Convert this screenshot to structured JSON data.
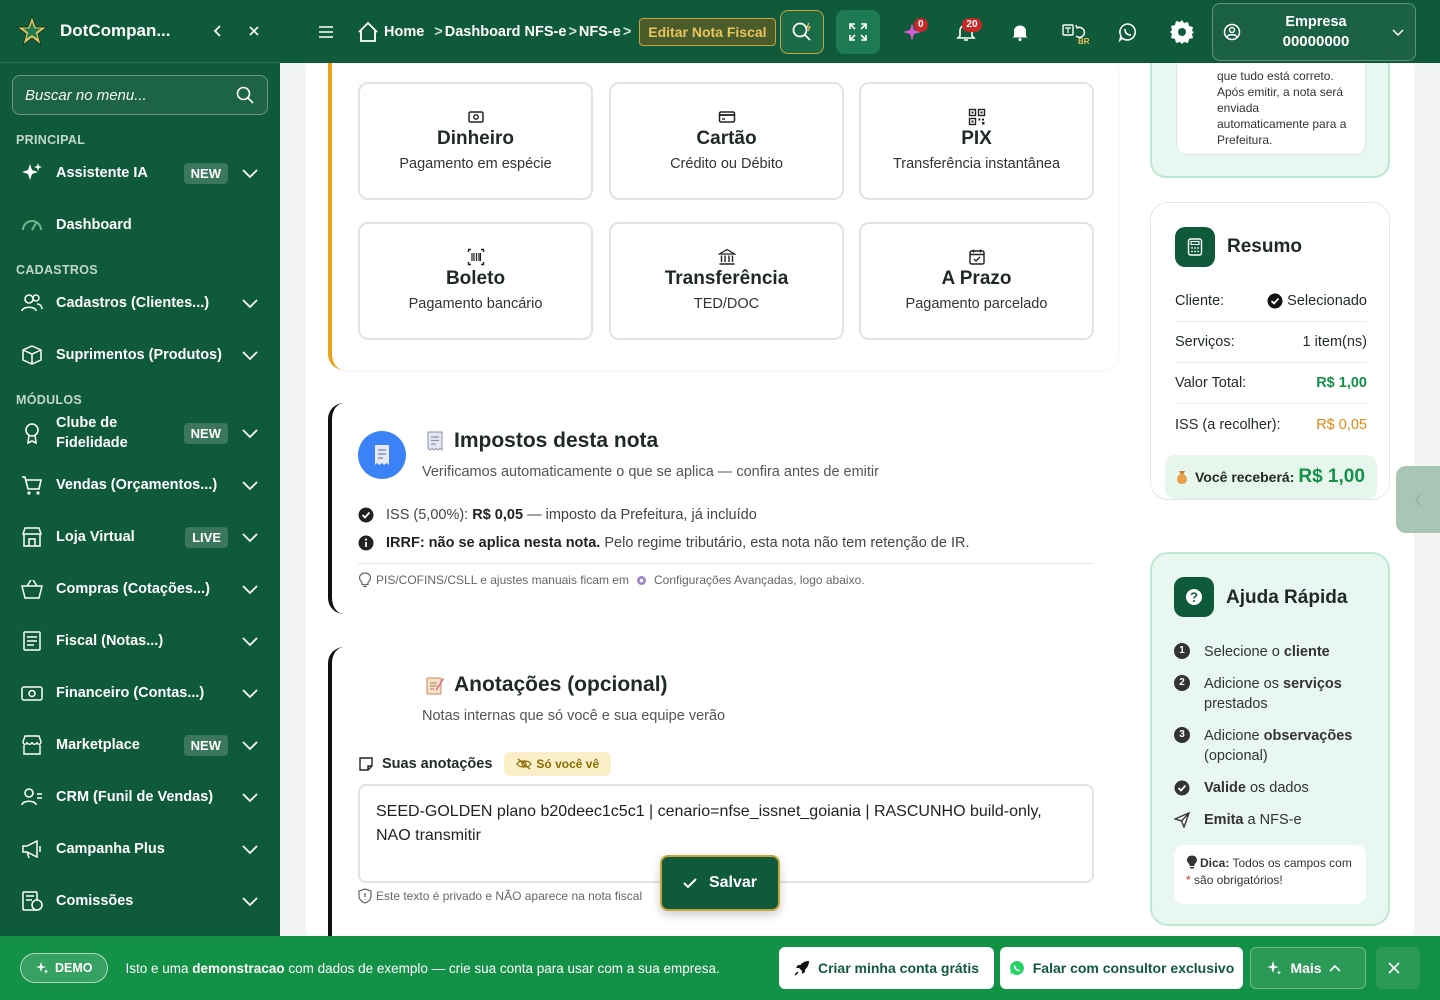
{
  "app": {
    "brand": "DotCompan..."
  },
  "sidebar": {
    "search_placeholder": "Buscar no menu...",
    "sections": {
      "principal": "PRINCIPAL",
      "cadastros": "CADASTROS",
      "modulos": "MÓDULOS"
    },
    "items": [
      {
        "label": "Assistente IA",
        "badge": "NEW",
        "icon": "sparkle-icon"
      },
      {
        "label": "Dashboard",
        "badge": "",
        "icon": "gauge-icon"
      },
      {
        "label": "Cadastros (Clientes...)",
        "badge": "",
        "icon": "users-icon"
      },
      {
        "label": "Suprimentos (Produtos)",
        "badge": "",
        "icon": "box-icon"
      },
      {
        "label": "Clube de Fidelidade",
        "badge": "NEW",
        "icon": "medal-icon"
      },
      {
        "label": "Vendas (Orçamentos...)",
        "badge": "",
        "icon": "cart-icon"
      },
      {
        "label": "Loja Virtual",
        "badge": "LIVE",
        "icon": "store-icon"
      },
      {
        "label": "Compras (Cotações...)",
        "badge": "",
        "icon": "basket-icon"
      },
      {
        "label": "Fiscal (Notas...)",
        "badge": "",
        "icon": "document-icon"
      },
      {
        "label": "Financeiro (Contas...)",
        "badge": "",
        "icon": "money-icon"
      },
      {
        "label": "Marketplace",
        "badge": "NEW",
        "icon": "shop-icon"
      },
      {
        "label": "CRM (Funil de Vendas)",
        "badge": "",
        "icon": "crm-icon"
      },
      {
        "label": "Campanha Plus",
        "badge": "",
        "icon": "megaphone-icon"
      },
      {
        "label": "Comissões",
        "badge": "",
        "icon": "commission-icon"
      }
    ]
  },
  "topbar": {
    "home": "Home",
    "crumbs": [
      "Dashboard NFS-e",
      "NFS-e"
    ],
    "current": "Editar Nota Fiscal",
    "ai_count": "0",
    "notif_count": "20",
    "lang_badge": "BR",
    "company_label": "Empresa",
    "company_id": "00000000"
  },
  "payment": {
    "options": [
      {
        "title": "Dinheiro",
        "subtitle": "Pagamento em espécie",
        "icon": "cash-icon"
      },
      {
        "title": "Cartão",
        "subtitle": "Crédito ou Débito",
        "icon": "card-icon"
      },
      {
        "title": "PIX",
        "subtitle": "Transferência instantânea",
        "icon": "qr-icon"
      },
      {
        "title": "Boleto",
        "subtitle": "Pagamento bancário",
        "icon": "barcode-icon"
      },
      {
        "title": "Transferência",
        "subtitle": "TED/DOC",
        "icon": "bank-icon"
      },
      {
        "title": "A Prazo",
        "subtitle": "Pagamento parcelado",
        "icon": "calendar-icon"
      }
    ]
  },
  "taxes": {
    "title": "Impostos desta nota",
    "subtitle": "Verificamos automaticamente o que se aplica — confira antes de emitir",
    "iss_label": "ISS (5,00%):",
    "iss_value": "R$ 0,05",
    "iss_note": "— imposto da Prefeitura, já incluído",
    "irrf_label": "IRRF: não se aplica nesta nota.",
    "irrf_note": "Pelo regime tributário, esta nota não tem retenção de IR.",
    "hint_a": "PIS/COFINS/CSLL e ajustes manuais ficam em",
    "hint_b": "Configurações Avançadas, logo abaixo."
  },
  "notes": {
    "title": "Anotações (opcional)",
    "subtitle": "Notas internas que só você e sua equipe verão",
    "label": "Suas anotações",
    "private_badge": "Só você vê",
    "value": "SEED-GOLDEN plano b20deec1c5c1 | cenario=nfse_issnet_goiania | RASCUNHO build-only, NAO transmitir",
    "hint": "Este texto é privado e NÃO aparece na nota fiscal",
    "save": "Salvar"
  },
  "top_info": {
    "text": "que tudo está correto. Após emitir, a nota será enviada automaticamente para a Prefeitura."
  },
  "summary": {
    "title": "Resumo",
    "rows": [
      {
        "label": "Cliente:",
        "value": "Selecionado"
      },
      {
        "label": "Serviços:",
        "value": "1 item(ns)"
      },
      {
        "label": "Valor Total:",
        "value": "R$ 1,00"
      },
      {
        "label": "ISS (a recolher):",
        "value": "R$ 0,05"
      }
    ],
    "receive_label": "Você receberá:",
    "receive_value": "R$ 1,00"
  },
  "help": {
    "title": "Ajuda Rápida",
    "steps": [
      {
        "num": "1",
        "pre": "Selecione o ",
        "bold": "cliente",
        "post": ""
      },
      {
        "num": "2",
        "pre": "Adicione os ",
        "bold": "serviços",
        "post": " prestados"
      },
      {
        "num": "3",
        "pre": "Adicione ",
        "bold": "observações",
        "post": " (opcional)"
      },
      {
        "num": "",
        "pre": "",
        "bold": "Valide",
        "post": " os dados"
      },
      {
        "num": "",
        "pre": "",
        "bold": "Emita",
        "post": " a NFS-e"
      }
    ],
    "tip_label": "Dica:",
    "tip_text": "Todos os campos com",
    "tip_star": "*",
    "tip_end": "são obrigatórios!"
  },
  "bottombar": {
    "demo": "DEMO",
    "text_pre": "Isto e uma ",
    "text_bold": "demonstracao",
    "text_post": " com dados de exemplo — crie sua conta para usar com a sua empresa.",
    "create": "Criar minha conta grátis",
    "talk": "Falar com consultor exclusivo",
    "more": "Mais"
  },
  "colors": {
    "brand": "#0f5a3a",
    "accent": "#c8a53a",
    "success": "#139146",
    "warning": "#e8a317"
  }
}
